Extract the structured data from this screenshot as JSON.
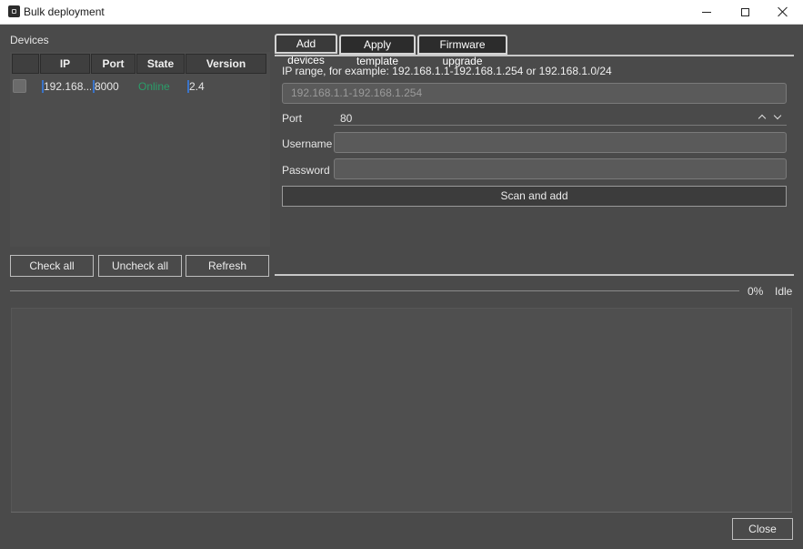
{
  "window": {
    "title": "Bulk deployment",
    "icons": {
      "app": "app-icon",
      "minimize": "minimize-icon",
      "maximize": "maximize-icon",
      "close": "close-icon"
    }
  },
  "devices": {
    "label": "Devices",
    "columns": [
      "",
      "IP",
      "Port",
      "State",
      "Version"
    ],
    "rows": [
      {
        "checked": false,
        "ip": "192.168...",
        "port": "8000",
        "state": "Online",
        "version": "2.4"
      }
    ],
    "buttons": {
      "check_all": "Check all",
      "uncheck_all": "Uncheck all",
      "refresh": "Refresh"
    }
  },
  "tabs": [
    "Add devices",
    "Apply template",
    "Firmware upgrade"
  ],
  "add_devices": {
    "ip_hint": "IP range, for example: 192.168.1.1-192.168.1.254 or 192.168.1.0/24",
    "ip_placeholder": "192.168.1.1-192.168.1.254",
    "port_label": "Port",
    "port_value": "80",
    "username_label": "Username",
    "username_value": "",
    "password_label": "Password",
    "password_value": "",
    "scan_button": "Scan and add"
  },
  "progress": {
    "percent_text": "0%",
    "fraction": 0,
    "status": "Idle"
  },
  "footer": {
    "close_button": "Close"
  },
  "colors": {
    "background": "#4a4a4a",
    "online": "#2a9e6a",
    "accent": "#3a74c9"
  }
}
